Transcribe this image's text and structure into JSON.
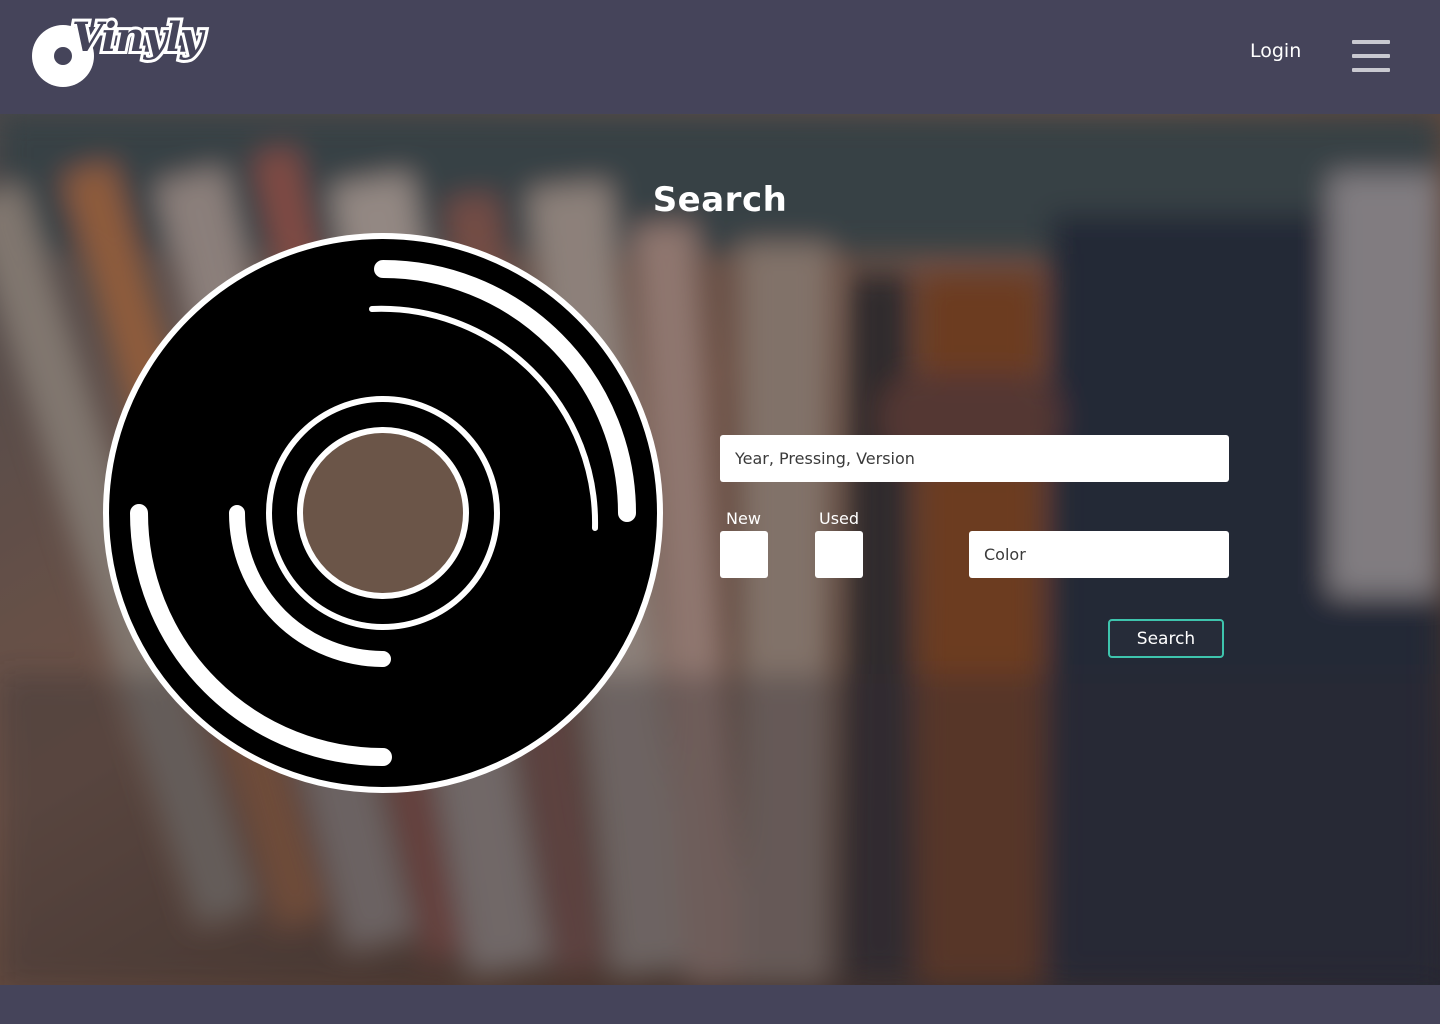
{
  "header": {
    "logo_text": "Vinyly",
    "login_label": "Login",
    "menu_icon": "hamburger-menu-icon"
  },
  "search": {
    "title": "Search",
    "query_placeholder": "Year, Pressing, Version",
    "new_label": "New",
    "used_label": "Used",
    "color_placeholder": "Color",
    "button_label": "Search"
  },
  "colors": {
    "header_bg": "#45445a",
    "button_border": "#3ec4ad",
    "vinyl_fill": "#000000"
  },
  "icons": {
    "record": "vinyl-record-icon"
  }
}
